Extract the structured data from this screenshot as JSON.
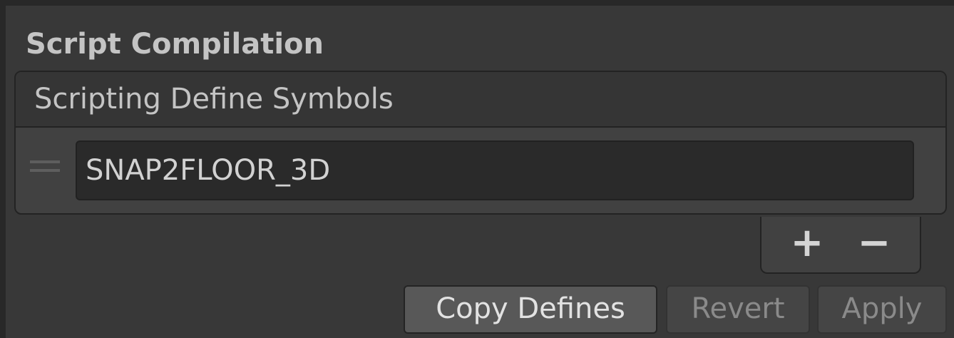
{
  "section": {
    "title": "Script Compilation"
  },
  "define_list": {
    "header": "Scripting Define Symbols",
    "items": [
      {
        "value": "SNAP2FLOOR_3D"
      }
    ],
    "add_label": "+",
    "remove_label": "−"
  },
  "buttons": {
    "copy_defines": "Copy Defines",
    "revert": "Revert",
    "apply": "Apply"
  },
  "icons": {
    "drag_handle": "drag-handle-icon"
  },
  "colors": {
    "background": "#383838",
    "frame": "#282828",
    "input_background": "#2a2a2a",
    "header_background": "#353535",
    "active_button": "#585858",
    "disabled_text": "#8a8a8a"
  }
}
